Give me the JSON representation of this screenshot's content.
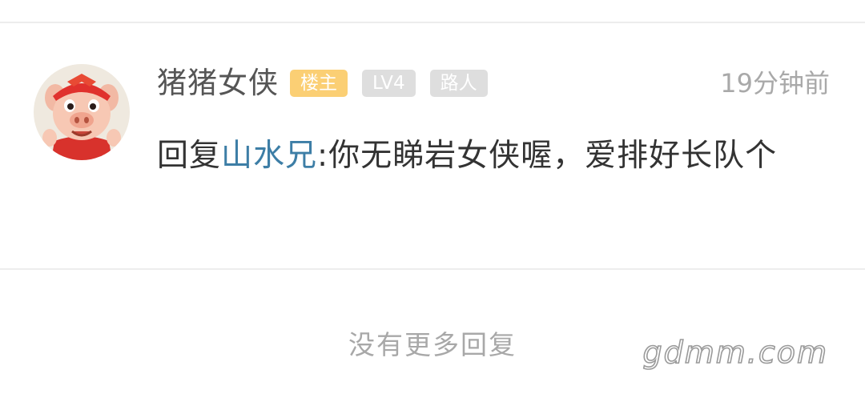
{
  "comment": {
    "username": "猪猪女侠",
    "badges": {
      "owner": "楼主",
      "level": "LV4",
      "rank": "路人"
    },
    "time": "19分钟前",
    "reply_prefix": "回复",
    "mention": "山水兄",
    "text": ":你无睇岩女侠喔，爱排好长队个"
  },
  "footer": {
    "no_more": "没有更多回复"
  },
  "watermark": "gdmm.com",
  "colors": {
    "owner_badge": "#fbcf74",
    "grey_badge": "#dedede",
    "mention_link": "#3d7ea6"
  },
  "icons": {
    "avatar": "cartoon-pig-hero-avatar"
  }
}
